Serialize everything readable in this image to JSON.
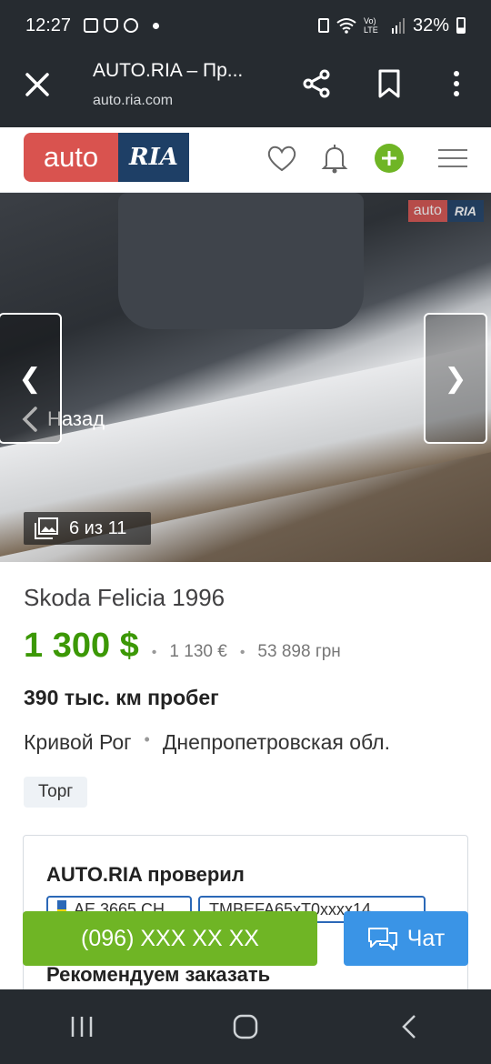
{
  "status": {
    "time": "12:27",
    "battery": "32%",
    "net": "Vo) LTE"
  },
  "browser": {
    "title": "AUTO.RIA – Пр...",
    "url": "auto.ria.com"
  },
  "site": {
    "logo_auto": "auto",
    "logo_ria": "RIA"
  },
  "gallery": {
    "back_label": "Назад",
    "counter": "6 из 11",
    "watermark_auto": "auto",
    "watermark_ria": "RIA",
    "prev": "❮",
    "next": "❯"
  },
  "listing": {
    "model": "Skoda Felicia 1996",
    "price_usd": "1 300 $",
    "price_eur": "1 130 €",
    "price_uah": "53 898 грн",
    "mileage": "390 тыс. км пробег",
    "city": "Кривой Рог",
    "region": "Днепропетровская обл.",
    "badge": "Торг"
  },
  "check_card": {
    "title": "AUTO.RIA проверил",
    "plate": "АЕ 3665 СН",
    "vin": "TMBEFA65xT0xxxx14",
    "recommend": "Рекомендуем заказать"
  },
  "actions": {
    "phone": "(096) XXX XX XX",
    "chat": "Чат"
  },
  "colors": {
    "price": "#3c9806",
    "call": "#6fb525",
    "chat": "#3a94e6",
    "logo_red": "#d9534f",
    "logo_blue": "#1e3f66"
  }
}
